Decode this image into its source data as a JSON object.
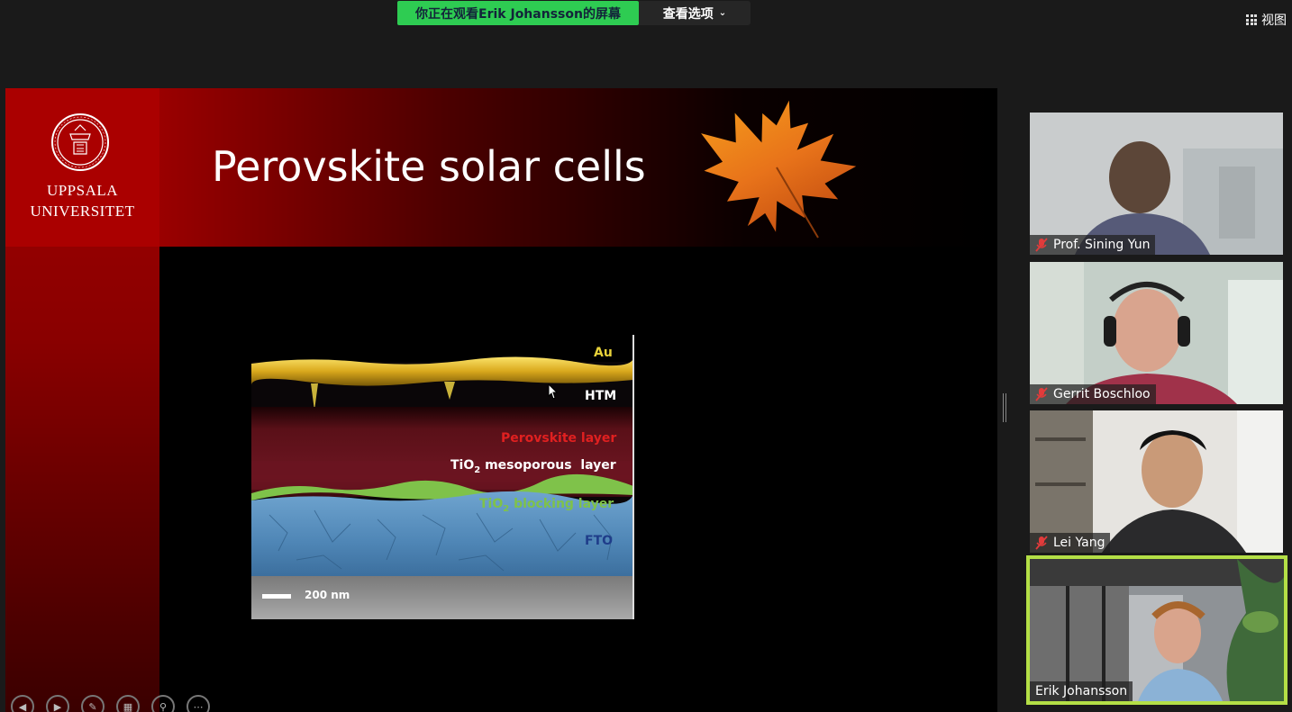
{
  "topbar": {
    "share_banner": "你正在观看Erik Johansson的屏幕",
    "view_options": "查看选项",
    "view_button": "视图"
  },
  "slide": {
    "logo_line1": "UPPSALA",
    "logo_line2": "UNIVERSITET",
    "title": "Perovskite solar cells",
    "sem_labels": {
      "au": "Au",
      "htm": "HTM",
      "perovskite": "Perovskite layer",
      "tio2_meso_prefix": "TiO",
      "tio2_meso_sub": "2",
      "tio2_meso_suffix": " mesoporous  layer",
      "tio2_block_prefix": "TiO",
      "tio2_block_sub": "2",
      "tio2_block_suffix": " blocking layer",
      "fto": "FTO",
      "scale": "200 nm"
    },
    "colors": {
      "au": "#e8d23a",
      "perovskite": "#e02020",
      "tio2_block": "#6cc04a",
      "fto": "#1f3d8a"
    }
  },
  "participants": [
    {
      "name": "Prof. Sining Yun",
      "muted": true,
      "active": false
    },
    {
      "name": "Gerrit Boschloo",
      "muted": true,
      "active": false
    },
    {
      "name": "Lei Yang",
      "muted": true,
      "active": false
    },
    {
      "name": "Erik Johansson",
      "muted": false,
      "active": true
    }
  ],
  "colors": {
    "share_green": "#2ecc52",
    "active_speaker": "#b4df46",
    "uppsala_red": "#aa0000"
  }
}
